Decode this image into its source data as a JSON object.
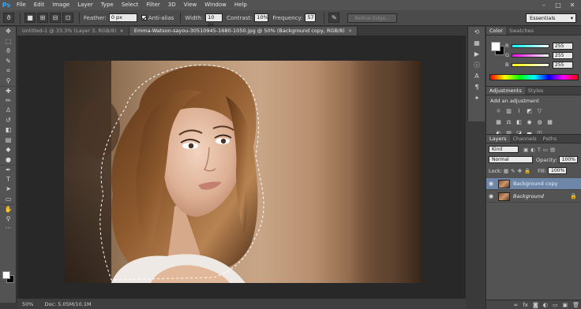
{
  "app": {
    "logo": "Ps"
  },
  "menu": [
    "File",
    "Edit",
    "Image",
    "Layer",
    "Type",
    "Select",
    "Filter",
    "3D",
    "View",
    "Window",
    "Help"
  ],
  "window_controls": [
    "–",
    "□",
    "✕"
  ],
  "options": {
    "feather_label": "Feather:",
    "feather_value": "0 px",
    "antialias_label": "Anti-alias",
    "width_label": "Width:",
    "width_value": "10 px",
    "contrast_label": "Contrast:",
    "contrast_value": "10%",
    "frequency_label": "Frequency:",
    "frequency_value": "57",
    "refine_edge_label": "Refine Edge...",
    "workspace": "Essentials"
  },
  "tabs": [
    {
      "label": "Untitled-1 @ 33.3% (Layer 3, RGB/8)",
      "active": false
    },
    {
      "label": "Emma-Watson-sayou-30510945-1680-1050.jpg @ 50% (Background copy, RGB/8)",
      "active": true
    }
  ],
  "status": {
    "zoom": "50%",
    "doc": "Doc: 5.05M/10.1M"
  },
  "color_panel": {
    "tabs": [
      "Color",
      "Swatches"
    ],
    "channels": [
      {
        "label": "R",
        "value": "255",
        "color": "#ff0000"
      },
      {
        "label": "G",
        "value": "255",
        "color": "#00ff00"
      },
      {
        "label": "B",
        "value": "255",
        "color": "#0000ff"
      }
    ]
  },
  "adjustments_panel": {
    "tabs": [
      "Adjustments",
      "Styles"
    ],
    "title": "Add an adjustment"
  },
  "layers_panel": {
    "tabs": [
      "Layers",
      "Channels",
      "Paths"
    ],
    "kind_filter": "Kind",
    "blend_mode": "Normal",
    "opacity_label": "Opacity:",
    "opacity_value": "100%",
    "lock_label": "Lock:",
    "fill_label": "Fill:",
    "fill_value": "100%",
    "layers": [
      {
        "name": "Background copy",
        "selected": true,
        "locked": false
      },
      {
        "name": "Background",
        "selected": false,
        "locked": true
      }
    ]
  },
  "colors": {
    "accent_blue": "#31a8ff",
    "selected_layer": "#6e87a8"
  }
}
